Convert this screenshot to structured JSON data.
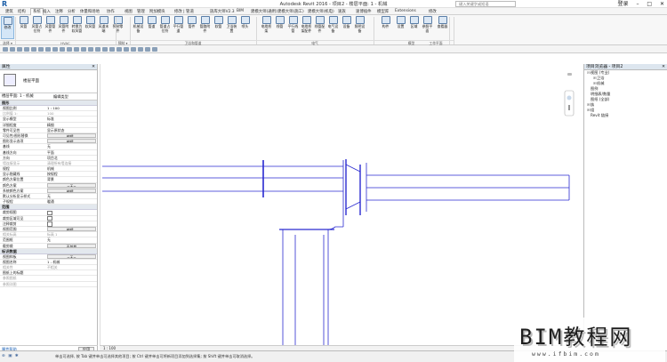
{
  "window": {
    "title": "Autodesk Revit 2016 - 项目2 - 楼层平面: 1 - 机械",
    "search_placeholder": "键入关键字或短语",
    "user": "登录"
  },
  "menu": [
    "建筑",
    "结构",
    "系统",
    "插入",
    "注释",
    "分析",
    "体量和场地",
    "协作",
    "视图",
    "管理",
    "附加模块",
    "修改 | 管道",
    "族库大师V2.3",
    "BIM",
    "建模大师(通用)",
    "建模大师(施工)",
    "建模大师(机电)",
    "速族",
    "速博插件",
    "模型库",
    "Extensions",
    "修改"
  ],
  "menu_active_index": 2,
  "ribbon": {
    "buttons": [
      {
        "label": "修改",
        "sel": true
      },
      {
        "label": "风管"
      },
      {
        "label": "风管占位符"
      },
      {
        "label": "风管管件"
      },
      {
        "label": "风管附件"
      },
      {
        "label": "转换为软风管"
      },
      {
        "label": "软风管"
      },
      {
        "label": "风道末端"
      },
      {
        "label": "预制零件"
      },
      {
        "label": "机械设备"
      },
      {
        "label": "管道"
      },
      {
        "label": "管道占位符"
      },
      {
        "label": "平行管道"
      },
      {
        "label": "管件"
      },
      {
        "label": "管路附件"
      },
      {
        "label": "软管"
      },
      {
        "label": "卫浴装置"
      },
      {
        "label": "喷头"
      },
      {
        "label": "电缆桥架"
      },
      {
        "label": "线管"
      },
      {
        "label": "平行线管"
      },
      {
        "label": "电缆桥架配件"
      },
      {
        "label": "线管配件"
      },
      {
        "label": "电气设备"
      },
      {
        "label": "设备"
      },
      {
        "label": "照明设备"
      },
      {
        "label": "构件"
      },
      {
        "label": "设置"
      },
      {
        "label": "区域"
      },
      {
        "label": "参照平面"
      },
      {
        "label": "查看器"
      }
    ],
    "groups": [
      {
        "label": "选择 ▾"
      },
      {
        "label": "HVAC"
      },
      {
        "label": "预制 ▾"
      },
      {
        "label": "卫浴和管道"
      },
      {
        "label": "电气"
      },
      {
        "label": "模型"
      },
      {
        "label": "工作平面"
      }
    ]
  },
  "properties": {
    "header": "属性",
    "close_icon": "✕",
    "type_name": "楼层平面",
    "instance": "楼层平面: 1 - 机械",
    "edit_type": "编辑类型",
    "sections": [
      {
        "title": "图形",
        "rows": [
          {
            "k": "视图比例",
            "v": "1 : 100"
          },
          {
            "k": "比例值 1:",
            "v": "100",
            "grey": true
          },
          {
            "k": "显示模型",
            "v": "标准"
          },
          {
            "k": "详细程度",
            "v": "精细"
          },
          {
            "k": "零件可见性",
            "v": "显示原状态"
          },
          {
            "k": "可见性/图形替换",
            "v": "编辑...",
            "btn": true
          },
          {
            "k": "图形显示选项",
            "v": "编辑...",
            "btn": true
          },
          {
            "k": "基线",
            "v": "无"
          },
          {
            "k": "基线方向",
            "v": "平面"
          },
          {
            "k": "方向",
            "v": "项目北"
          },
          {
            "k": "墙连接显示",
            "v": "清理所有墙连接",
            "grey": true
          },
          {
            "k": "规程",
            "v": "机械"
          },
          {
            "k": "显示隐藏线",
            "v": "按规程"
          },
          {
            "k": "颜色方案位置",
            "v": "背景"
          },
          {
            "k": "颜色方案",
            "v": "<无>",
            "btn": true
          },
          {
            "k": "系统颜色方案",
            "v": "编辑...",
            "btn": true
          },
          {
            "k": "默认分析显示样式",
            "v": "无"
          },
          {
            "k": "子规程",
            "v": "暖通"
          }
        ]
      },
      {
        "title": "范围",
        "rows": [
          {
            "k": "裁剪视图",
            "v": "",
            "chk": true
          },
          {
            "k": "裁剪区域可见",
            "v": "",
            "chk": true
          },
          {
            "k": "注释裁剪",
            "v": "",
            "chk": true
          },
          {
            "k": "视图范围",
            "v": "编辑...",
            "btn": true
          },
          {
            "k": "相关标高",
            "v": "标高 1",
            "grey": true
          },
          {
            "k": "范围框",
            "v": "无"
          },
          {
            "k": "截剪裁",
            "v": "不剪裁",
            "btn": true
          }
        ]
      },
      {
        "title": "标识数据",
        "rows": [
          {
            "k": "视图样板",
            "v": "<无>",
            "btn": true
          },
          {
            "k": "视图名称",
            "v": "1 - 机械"
          },
          {
            "k": "相关性",
            "v": "不相关",
            "grey": true
          },
          {
            "k": "图纸上的标题",
            "v": ""
          },
          {
            "k": "参照图纸",
            "v": "",
            "grey": true
          },
          {
            "k": "参照详图",
            "v": "",
            "grey": true
          }
        ]
      }
    ],
    "help": "属性帮助",
    "apply": "应用"
  },
  "browser": {
    "header": "项目浏览器 - 项目2",
    "close_icon": "✕",
    "tree": [
      {
        "t": "视图 (专业)",
        "lvl": 0,
        "tog": "⊟"
      },
      {
        "t": "卫浴",
        "lvl": 1,
        "tog": "⊞"
      },
      {
        "t": "机械",
        "lvl": 1,
        "tog": "⊞"
      },
      {
        "t": "图例",
        "lvl": 0,
        "tog": ""
      },
      {
        "t": "明细表/数量",
        "lvl": 0,
        "tog": ""
      },
      {
        "t": "图纸 (全部)",
        "lvl": 0,
        "tog": ""
      },
      {
        "t": "族",
        "lvl": 0,
        "tog": "⊞"
      },
      {
        "t": "组",
        "lvl": 0,
        "tog": "⊞"
      },
      {
        "t": "Revit 链接",
        "lvl": 0,
        "tog": ""
      }
    ]
  },
  "view_control": {
    "scale": "1 : 100"
  },
  "status": {
    "text": "单击可选择, 按 Tab 键并单击可选择其他项目; 按 Ctrl 键并单击可将新项目添加到选择集; 按 Shift 键并单击可取消选择。",
    "right": ":0"
  },
  "watermark": {
    "logo": "BIM教程网",
    "url": "www.ifbim.com"
  },
  "colors": {
    "pipe": "#2a2ad0",
    "accent": "#1a5fb4"
  }
}
